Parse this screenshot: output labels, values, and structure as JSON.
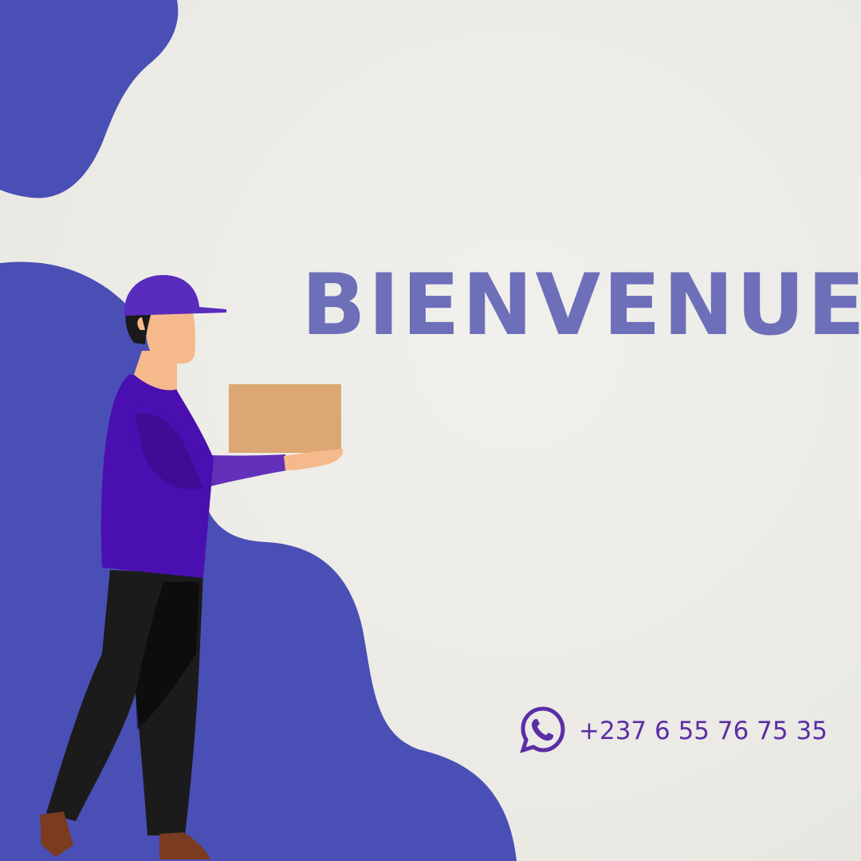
{
  "heading": "BIENVENUE",
  "contact": {
    "icon": "whatsapp-icon",
    "phone": "+237 6 55 76 75 35"
  },
  "colors": {
    "blob": "#4a4fb6",
    "heading": "#6d6fb9",
    "accent": "#5b2ea6",
    "shirt": "#4a0fb0",
    "cap": "#5a2bbf",
    "box": "#dca772",
    "skin": "#f6b98c",
    "pants": "#1b1b1b",
    "shoes": "#7a3b1f",
    "paper": "#ecebe6"
  }
}
